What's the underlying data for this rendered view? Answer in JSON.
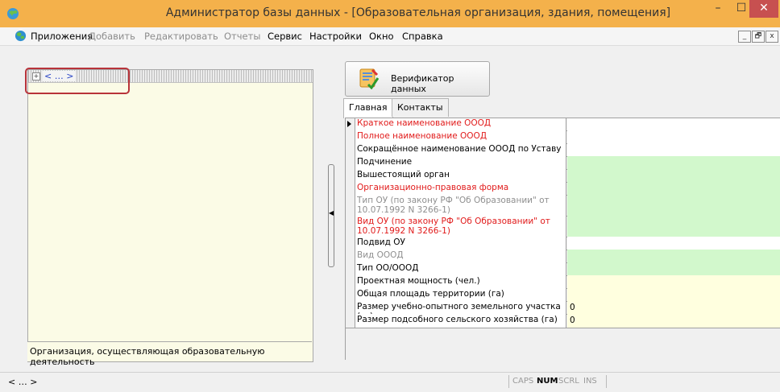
{
  "window": {
    "title": "Администратор базы данных - [Образовательная организация, здания, помещения]",
    "min_glyph": "–",
    "max_glyph": "☐",
    "close_glyph": "✕",
    "icon": "app-globe-icon"
  },
  "menu": {
    "items": [
      {
        "label": "Приложения",
        "enabled": true
      },
      {
        "label": "Добавить",
        "enabled": false
      },
      {
        "label": "Редактировать",
        "enabled": false
      },
      {
        "label": "Отчеты",
        "enabled": false
      },
      {
        "label": "Сервис",
        "enabled": true
      },
      {
        "label": "Настройки",
        "enabled": true
      },
      {
        "label": "Окно",
        "enabled": true
      },
      {
        "label": "Справка",
        "enabled": true
      }
    ],
    "mdi_buttons": [
      "_",
      "🗗",
      "x"
    ]
  },
  "tree": {
    "node_text": "< … >",
    "expander": "+",
    "footer": "Организация, осуществляющая образовательную деятельность"
  },
  "toolbar": {
    "verify_label": "Верификатор данных",
    "verify_icon": "data-verifier-icon"
  },
  "tabs": [
    {
      "label": "Главная",
      "active": true
    },
    {
      "label": "Контакты",
      "active": false
    }
  ],
  "grid": {
    "rows": [
      {
        "label": "Краткое наименование ОООД",
        "style": "required",
        "value": "",
        "fill": "white",
        "current": true
      },
      {
        "label": "Полное наименование ОООД",
        "style": "required",
        "value": "",
        "fill": "white"
      },
      {
        "label": "Сокращённое наименование ОООД по Уставу",
        "style": "normal",
        "value": "",
        "fill": "white"
      },
      {
        "label": "Подчинение",
        "style": "normal",
        "value": "",
        "fill": "green"
      },
      {
        "label": "Вышестоящий орган",
        "style": "normal",
        "value": "",
        "fill": "green"
      },
      {
        "label": "Организационно-правовая форма",
        "style": "required",
        "value": "",
        "fill": "green"
      },
      {
        "label": "Тип ОУ (по закону РФ \"Об Образовании\" от 10.07.1992 N 3266-1)",
        "style": "disabled",
        "value": "",
        "fill": "green"
      },
      {
        "label": "Вид ОУ (по закону РФ \"Об Образовании\" от 10.07.1992 N 3266-1)",
        "style": "required",
        "value": "",
        "fill": "green"
      },
      {
        "label": "Подвид ОУ",
        "style": "normal",
        "value": "",
        "fill": "white"
      },
      {
        "label": "Вид ОООД",
        "style": "disabled",
        "value": "",
        "fill": "green"
      },
      {
        "label": "Тип ОО/ОООД",
        "style": "normal",
        "value": "",
        "fill": "green"
      },
      {
        "label": "Проектная мощность (чел.)",
        "style": "normal",
        "value": "",
        "fill": "yellow"
      },
      {
        "label": "Общая площадь территории (га)",
        "style": "normal",
        "value": "",
        "fill": "yellow"
      },
      {
        "label": "Размер учебно-опытного земельного участка (га)",
        "style": "normal",
        "value": "0",
        "fill": "yellow"
      },
      {
        "label": "Размер подсобного сельского хозяйства (га)",
        "style": "normal",
        "value": "0",
        "fill": "yellow"
      }
    ]
  },
  "status": {
    "nav": "< … >",
    "indicators": [
      {
        "label": "CAPS",
        "active": false
      },
      {
        "label": "NUM",
        "active": true
      },
      {
        "label": "SCRL",
        "active": false
      },
      {
        "label": "INS",
        "active": false
      }
    ]
  },
  "colors": {
    "titlebar": "#f4b14b",
    "close": "#c75050",
    "required_text": "#e11b1b",
    "green_cell": "#d2f8cc",
    "yellow_cell": "#ffffdf",
    "tree_bg": "#fbfbe6",
    "highlight": "#b8333a"
  }
}
